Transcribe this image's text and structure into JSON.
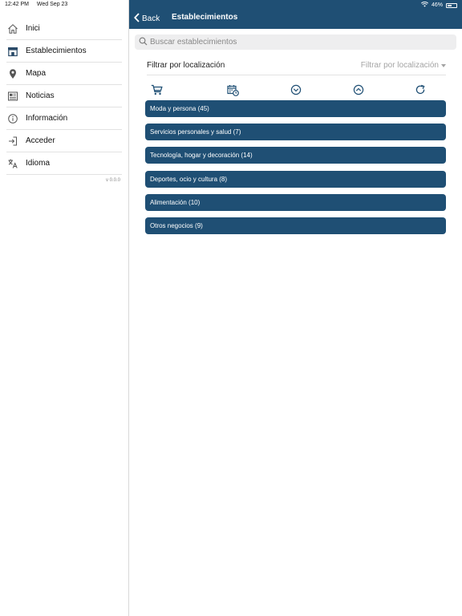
{
  "status": {
    "time": "12:42 PM",
    "date": "Wed Sep 23",
    "battery": "46%"
  },
  "sidebar": {
    "items": [
      {
        "label": "Inici",
        "icon": "home-icon"
      },
      {
        "label": "Establecimientos",
        "icon": "store-icon"
      },
      {
        "label": "Mapa",
        "icon": "map-pin-icon"
      },
      {
        "label": "Noticias",
        "icon": "newspaper-icon"
      },
      {
        "label": "Información",
        "icon": "info-icon"
      },
      {
        "label": "Acceder",
        "icon": "login-icon"
      },
      {
        "label": "Idioma",
        "icon": "translate-icon"
      }
    ],
    "version": "v 0.0.0"
  },
  "navbar": {
    "back_label": "Back",
    "title": "Establecimientos"
  },
  "search": {
    "placeholder": "Buscar establecimientos"
  },
  "filter": {
    "label": "Filtrar por localización",
    "select_value": "Filtrar por localización"
  },
  "toolbar": {
    "icons": [
      "cart-icon",
      "calendar-clock-icon",
      "expand-all-icon",
      "collapse-all-icon",
      "refresh-icon"
    ]
  },
  "categories": [
    "Moda y persona (45)",
    "Servicios personales y salud (7)",
    "Tecnología, hogar y decoración (14)",
    "Deportes, ocio y cultura (8)",
    "Alimentación (10)",
    "Otros negocios (9)"
  ],
  "colors": {
    "brand": "#1f4f74",
    "background": "#ffffff"
  }
}
